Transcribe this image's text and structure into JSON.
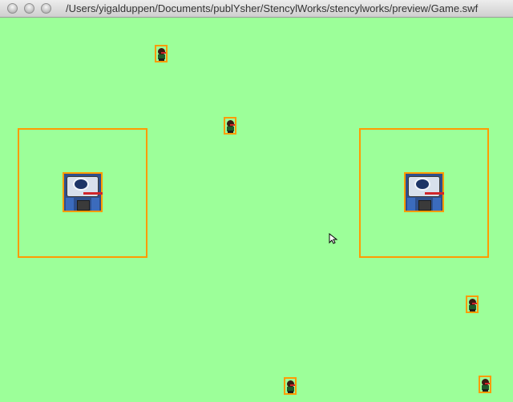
{
  "window": {
    "title": "/Users/yigalduppen/Documents/publYsher/StencylWorks/stencylworks/preview/Game.swf"
  },
  "colors": {
    "background": "#9cff99",
    "outline": "#ff9b00"
  },
  "icons": {
    "tower": "turret-icon",
    "enemy": "enemy-sprite-icon",
    "cursor": "mouse-pointer-icon"
  }
}
